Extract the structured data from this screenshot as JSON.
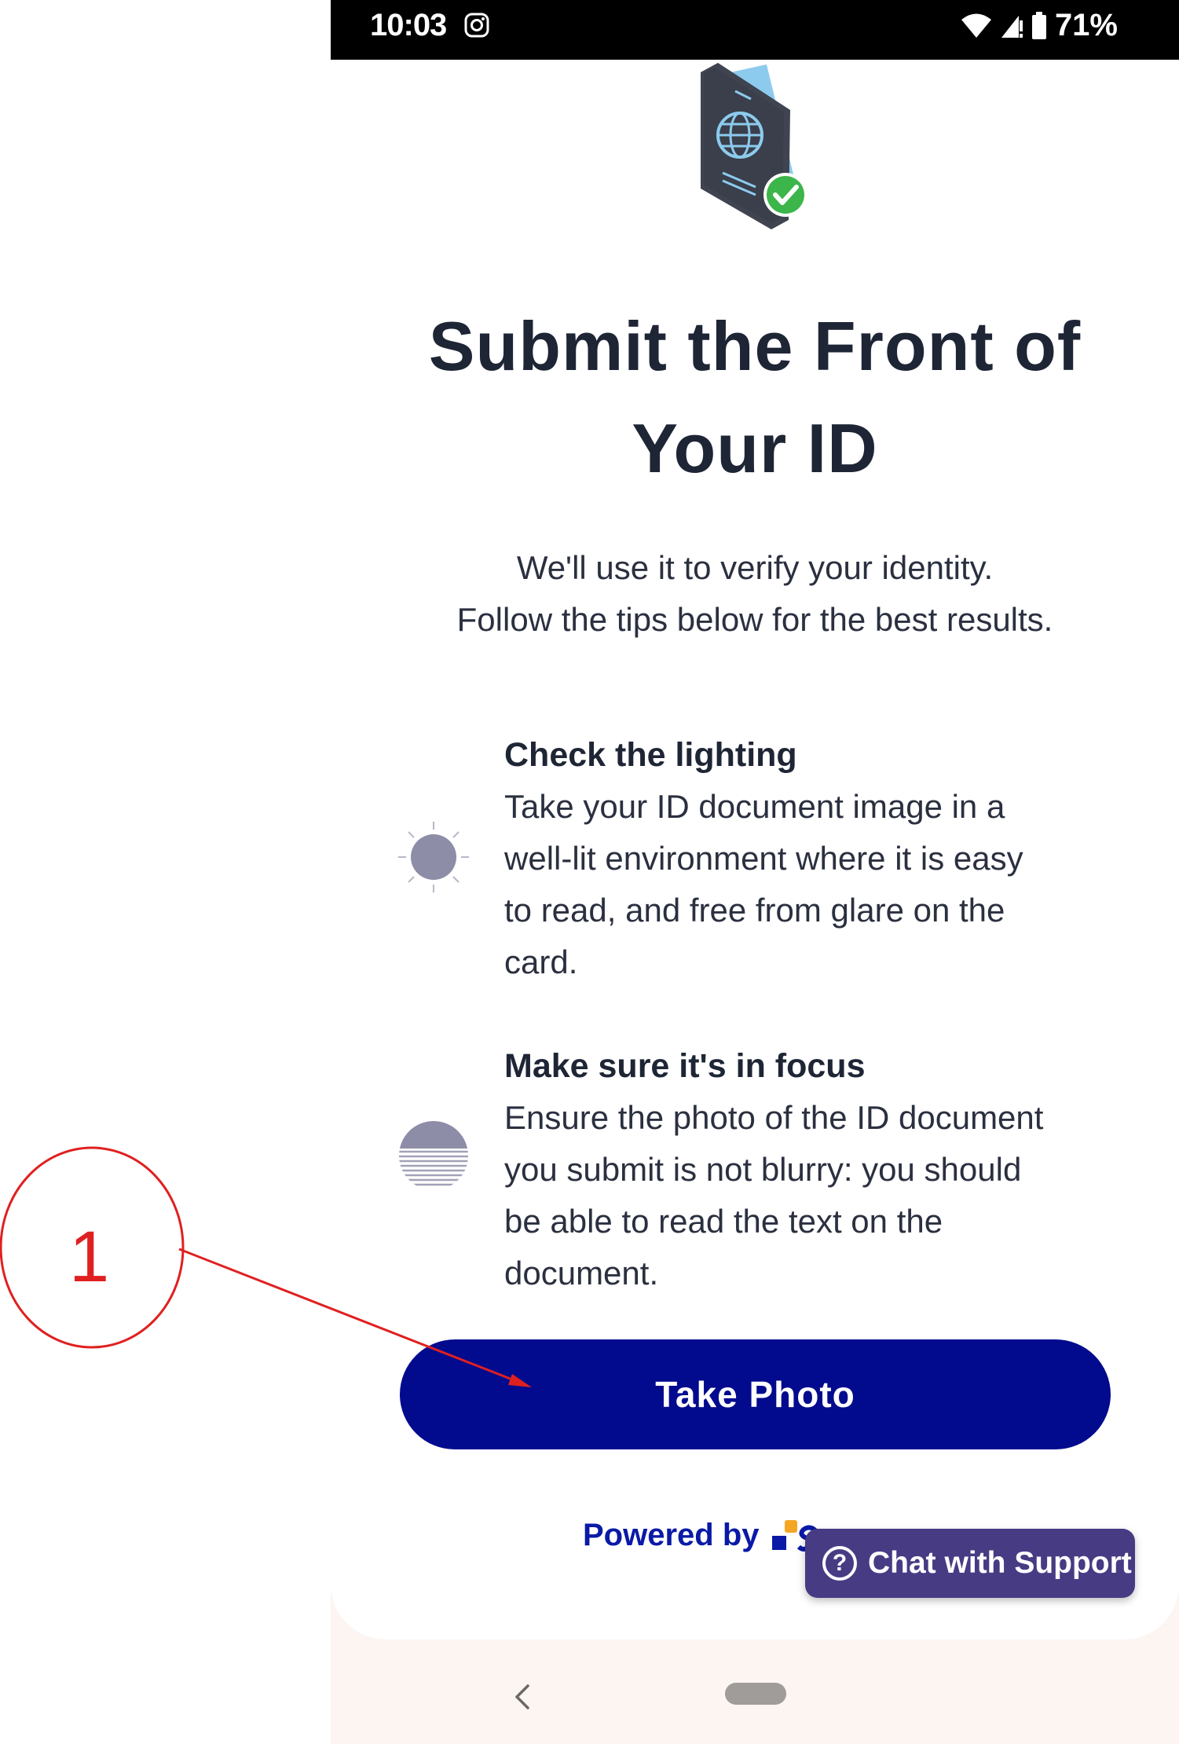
{
  "status_bar": {
    "time": "10:03",
    "battery": "71%"
  },
  "page": {
    "title_line1": "Submit the Front of",
    "title_line2": "Your ID",
    "subtitle_line1": "We'll use it to verify your identity.",
    "subtitle_line2": "Follow the tips below for the best results."
  },
  "tips": [
    {
      "title": "Check the lighting",
      "lines": [
        "Take your ID document image in a",
        "well-lit environment where it is easy",
        "to read, and free from glare on the",
        "card."
      ],
      "icon": "sun-icon"
    },
    {
      "title": "Make sure it's in focus",
      "lines": [
        "Ensure the photo of the ID document",
        "you submit is not blurry: you should",
        "be able to read the text on the",
        "document."
      ],
      "icon": "blur-icon"
    }
  ],
  "actions": {
    "take_photo": "Take Photo",
    "chat_support": "Chat with Support"
  },
  "footer": {
    "powered_by": "Powered by"
  },
  "annotation": {
    "label": "1"
  },
  "colors": {
    "primary": "#020b8e",
    "title": "#1e2535",
    "chat": "#473b84",
    "success": "#3cb54a",
    "annotation": "#e02020"
  }
}
